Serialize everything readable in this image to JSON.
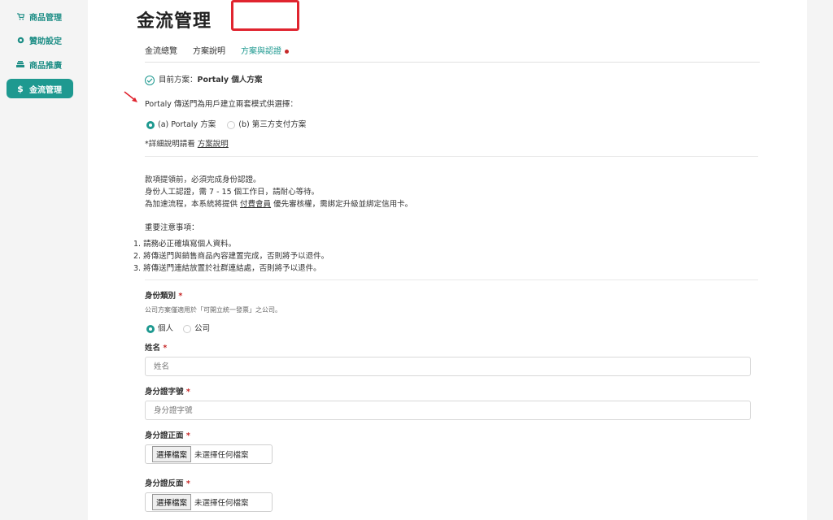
{
  "sidebar": {
    "items": [
      {
        "label": "商品管理",
        "icon": "cart-icon"
      },
      {
        "label": "贊助設定",
        "icon": "gear-icon"
      },
      {
        "label": "商品推廣",
        "icon": "stack-icon"
      },
      {
        "label": "金流管理",
        "icon": "dollar-icon"
      }
    ],
    "active_index": 3
  },
  "page": {
    "title": "金流管理",
    "tabs": [
      "金流總覽",
      "方案說明",
      "方案與認證"
    ],
    "active_tab": 2
  },
  "plan": {
    "current_prefix": "目前方案：",
    "current_value": "Portaly 個人方案",
    "question": "Portaly 傳送門為用戶建立兩套模式供選擇：",
    "option_a": "(a) Portaly 方案",
    "option_b": "(b) 第三方支付方案",
    "detail_prefix": "*詳細說明請看",
    "detail_link": "方案說明"
  },
  "notice": {
    "line1": "款項提領前，必須完成身份認證。",
    "line2": "身份人工認證，需 7 - 15 個工作日，請耐心等待。",
    "line3_prefix": "為加速流程，本系統將提供",
    "line3_link": "付費會員",
    "line3_suffix": "優先審核權，需綁定升級並綁定信用卡。",
    "important_title": "重要注意事項：",
    "items": [
      "1. 請務必正確填寫個人資料。",
      "2. 將傳送門與銷售商品內容建置完成，否則將予以退件。",
      "3. 將傳送門連結放置於社群連結處，否則將予以退件。"
    ]
  },
  "form": {
    "identity_label": "身份類別",
    "identity_hint": "公司方案僅適用於「可開立統一發票」之公司。",
    "identity_options": [
      "個人",
      "公司"
    ],
    "name_label": "姓名",
    "name_placeholder": "姓名",
    "id_label": "身分證字號",
    "id_placeholder": "身分證字號",
    "id_front_label": "身分證正面",
    "id_back_label": "身分證反面",
    "file_button": "選擇檔案",
    "file_status": "未選擇任何檔案",
    "required_mark": "*"
  },
  "colors": {
    "accent": "#1e9990",
    "highlight": "#e0242f",
    "required": "#c62828"
  }
}
